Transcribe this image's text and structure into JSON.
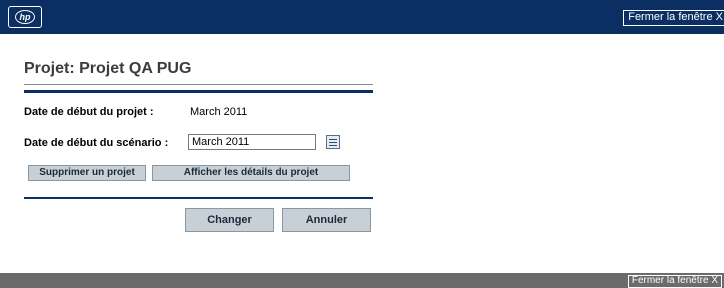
{
  "header": {
    "logo_icon": "hp-logo-icon",
    "logo_text": "hp",
    "close_label": "Fermer la fenêtre",
    "close_symbol": "X"
  },
  "form": {
    "title": "Projet: Projet QA PUG",
    "project_start_label": "Date de début du projet :",
    "project_start_value": "March 2011",
    "scenario_start_label": "Date de début du scénario :",
    "scenario_start_value": "March 2011",
    "calendar_icon": "calendar-icon",
    "delete_project_label": "Supprimer un projet",
    "show_details_label": "Afficher les détails du projet",
    "change_label": "Changer",
    "cancel_label": "Annuler"
  },
  "footer": {
    "close_label": "Fermer la fenêtre",
    "close_symbol": "X"
  },
  "colors": {
    "header_bg": "#0b2f63",
    "footer_bg": "#6b6b6b",
    "button_bg": "#c8d0d6",
    "accent_rule": "#0b2f63"
  }
}
